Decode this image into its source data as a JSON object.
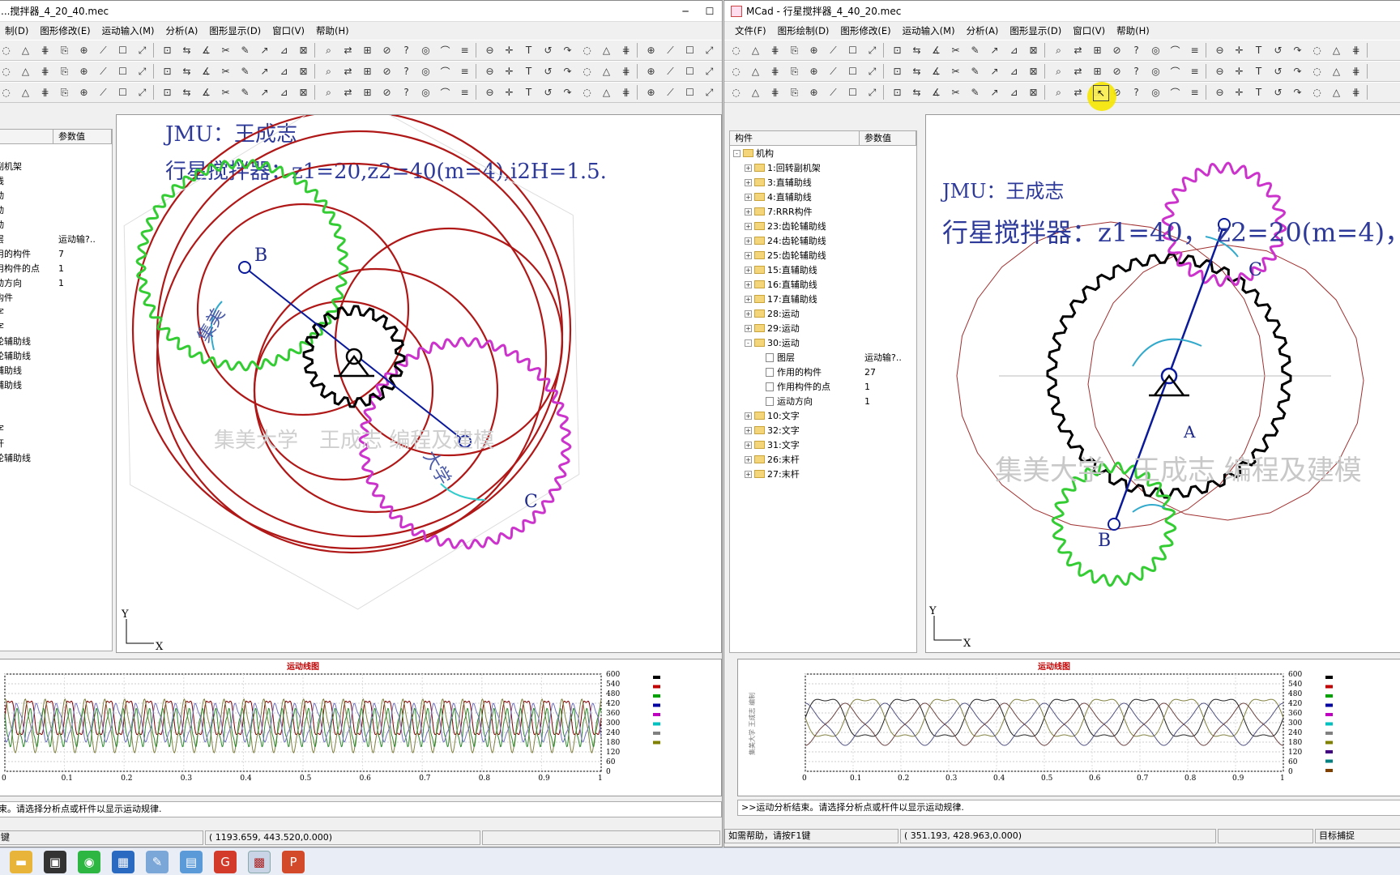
{
  "left_window": {
    "title": "...搅拌器_4_20_40.mec",
    "menus": [
      "制(D)",
      "图形修改(E)",
      "运动输入(M)",
      "分析(A)",
      "图形显示(D)",
      "窗口(V)",
      "帮助(H)"
    ],
    "tree_header": {
      "col2": "参数值"
    },
    "tree_rows": [
      {
        "name": "",
        "value": ""
      },
      {
        "name": "副机架",
        "value": ""
      },
      {
        "name": "线",
        "value": ""
      },
      {
        "name": "动",
        "value": ""
      },
      {
        "name": "动",
        "value": ""
      },
      {
        "name": "动",
        "value": ""
      },
      {
        "name": "层",
        "value": "运动输?.."
      },
      {
        "name": "用的构件",
        "value": "7"
      },
      {
        "name": "用构件的点",
        "value": "1"
      },
      {
        "name": "动方向",
        "value": "1"
      },
      {
        "name": "构件",
        "value": ""
      },
      {
        "name": "字",
        "value": ""
      },
      {
        "name": "字",
        "value": ""
      },
      {
        "name": "轮辅助线",
        "value": ""
      },
      {
        "name": "轮辅助线",
        "value": ""
      },
      {
        "name": "辅助线",
        "value": ""
      },
      {
        "name": "辅助线",
        "value": ""
      },
      {
        "name": "",
        "value": ""
      },
      {
        "name": "",
        "value": ""
      },
      {
        "name": "字",
        "value": ""
      },
      {
        "name": "杆",
        "value": ""
      },
      {
        "name": "轮辅助线",
        "value": ""
      }
    ],
    "canvas": {
      "author": "JMU：王成志",
      "subtitle": "行星搅拌器：z1=20,z2=40(m=4),i2H=1.5.",
      "label_b": "B",
      "label_c": "C",
      "watermark": "集美大学　王成志 编程及建模",
      "gear_text_1": "集美",
      "gear_text_2": "大学",
      "axis_y": "Y",
      "axis_x": "X"
    },
    "chart_title": "运动线图",
    "command": "束。请选择分析点或杆件以显示运动规律.",
    "status_left": "l键",
    "status_coords": "( 1193.659,   443.520,0.000)"
  },
  "right_window": {
    "title": "MCad - 行星搅拌器_4_40_20.mec",
    "menus": [
      "文件(F)",
      "图形绘制(D)",
      "图形修改(E)",
      "运动输入(M)",
      "分析(A)",
      "图形显示(D)",
      "窗口(V)",
      "帮助(H)"
    ],
    "tree_header": {
      "col1": "构件",
      "col2": "参数值"
    },
    "tree_rows": [
      {
        "level": 0,
        "kind": "folder",
        "expand": "-",
        "name": "机构",
        "value": ""
      },
      {
        "level": 1,
        "kind": "folder",
        "expand": "+",
        "name": "1:回转副机架",
        "value": ""
      },
      {
        "level": 1,
        "kind": "folder",
        "expand": "+",
        "name": "3:直辅助线",
        "value": ""
      },
      {
        "level": 1,
        "kind": "folder",
        "expand": "+",
        "name": "4:直辅助线",
        "value": ""
      },
      {
        "level": 1,
        "kind": "folder",
        "expand": "+",
        "name": "7:RRR构件",
        "value": ""
      },
      {
        "level": 1,
        "kind": "folder",
        "expand": "+",
        "name": "23:齿轮辅助线",
        "value": ""
      },
      {
        "level": 1,
        "kind": "folder",
        "expand": "+",
        "name": "24:齿轮辅助线",
        "value": ""
      },
      {
        "level": 1,
        "kind": "folder",
        "expand": "+",
        "name": "25:齿轮辅助线",
        "value": ""
      },
      {
        "level": 1,
        "kind": "folder",
        "expand": "+",
        "name": "15:直辅助线",
        "value": ""
      },
      {
        "level": 1,
        "kind": "folder",
        "expand": "+",
        "name": "16:直辅助线",
        "value": ""
      },
      {
        "level": 1,
        "kind": "folder",
        "expand": "+",
        "name": "17:直辅助线",
        "value": ""
      },
      {
        "level": 1,
        "kind": "folder",
        "expand": "+",
        "name": "28:运动",
        "value": ""
      },
      {
        "level": 1,
        "kind": "folder",
        "expand": "+",
        "name": "29:运动",
        "value": ""
      },
      {
        "level": 1,
        "kind": "folder",
        "expand": "-",
        "name": "30:运动",
        "value": ""
      },
      {
        "level": 2,
        "kind": "doc",
        "expand": "",
        "name": "图层",
        "value": "运动输?.."
      },
      {
        "level": 2,
        "kind": "doc",
        "expand": "",
        "name": "作用的构件",
        "value": "27"
      },
      {
        "level": 2,
        "kind": "doc",
        "expand": "",
        "name": "作用构件的点",
        "value": "1"
      },
      {
        "level": 2,
        "kind": "doc",
        "expand": "",
        "name": "运动方向",
        "value": "1"
      },
      {
        "level": 1,
        "kind": "folder",
        "expand": "+",
        "name": "10:文字",
        "value": ""
      },
      {
        "level": 1,
        "kind": "folder",
        "expand": "+",
        "name": "32:文字",
        "value": ""
      },
      {
        "level": 1,
        "kind": "folder",
        "expand": "+",
        "name": "31:文字",
        "value": ""
      },
      {
        "level": 1,
        "kind": "folder",
        "expand": "+",
        "name": "26:末杆",
        "value": ""
      },
      {
        "level": 1,
        "kind": "folder",
        "expand": "+",
        "name": "27:末杆",
        "value": ""
      }
    ],
    "canvas": {
      "author": "JMU：王成志",
      "subtitle": "行星搅拌器：z1=40， z2=20(m=4)，i2",
      "label_a": "A",
      "label_b": "B",
      "label_c": "C",
      "watermark": "集美大学　王成志 编程及建模",
      "axis_y": "Y",
      "axis_x": "X"
    },
    "chart_title": "运动线图",
    "chart_side_text": "集美大学 王成志 编制",
    "command": ">>运动分析结束。请选择分析点或杆件以显示运动规律.",
    "status_left": "如需帮助，请按F1键",
    "status_coords": "(   351.193,   428.963,0.000)",
    "status_right": "目标捕捉"
  },
  "chart_data": [
    {
      "type": "line",
      "title": "运动线图",
      "x_ticks": [
        "0",
        "0.1",
        "0.2",
        "0.3",
        "0.4",
        "0.5",
        "0.6",
        "0.7",
        "0.8",
        "0.9",
        "1"
      ],
      "y_ticks": [
        "0",
        "60",
        "120",
        "180",
        "240",
        "300",
        "360",
        "420",
        "480",
        "540",
        "600"
      ],
      "xlim": [
        0,
        1
      ],
      "ylim": [
        0,
        600
      ],
      "series": [
        {
          "color": "#800000",
          "cycles": 30,
          "mean": 330,
          "amp": 190
        },
        {
          "color": "#808040",
          "cycles": 30,
          "mean": 280,
          "amp": 170
        },
        {
          "color": "#2e8b2e",
          "cycles": 45,
          "mean": 270,
          "amp": 150
        },
        {
          "color": "#7070c0",
          "cycles": 30,
          "mean": 300,
          "amp": 150
        }
      ],
      "legend_colors": [
        "#000000",
        "#c00000",
        "#00a000",
        "#0000a0",
        "#c000c0",
        "#00c0c0",
        "#808080",
        "#808000"
      ]
    },
    {
      "type": "line",
      "title": "运动线图",
      "x_ticks": [
        "0",
        "0.1",
        "0.2",
        "0.3",
        "0.4",
        "0.5",
        "0.6",
        "0.7",
        "0.8",
        "0.9",
        "1"
      ],
      "y_ticks": [
        "0",
        "60",
        "120",
        "180",
        "240",
        "300",
        "360",
        "420",
        "480",
        "540",
        "600"
      ],
      "xlim": [
        0,
        1
      ],
      "ylim": [
        0,
        600
      ],
      "series": [
        {
          "color": "#222222",
          "cycles": 6,
          "mean": 330,
          "amp": 210,
          "phase": 0.0
        },
        {
          "color": "#808040",
          "cycles": 6,
          "mean": 330,
          "amp": 210,
          "phase": 0.5
        },
        {
          "color": "#505080",
          "cycles": 6,
          "mean": 290,
          "amp": 130,
          "phase": 0.25
        },
        {
          "color": "#6a4040",
          "cycles": 6,
          "mean": 290,
          "amp": 130,
          "phase": 0.75
        }
      ],
      "legend_colors": [
        "#000000",
        "#c00000",
        "#00a000",
        "#0000a0",
        "#c000c0",
        "#00c0c0",
        "#808080",
        "#808000",
        "#400080",
        "#008080",
        "#804000"
      ]
    }
  ],
  "colors": {
    "highlight": "#f6e600",
    "link": "#0a1a9a",
    "green_gear": "#33cc33",
    "magenta_gear": "#cc33cc",
    "ring": "#b01818"
  },
  "taskbar_icons": [
    "file-explorer-icon",
    "store-icon",
    "wechat-icon",
    "calculator-icon",
    "paint-icon",
    "notepad-icon",
    "wps-icon",
    "mcad-icon",
    "powerpoint-icon"
  ]
}
